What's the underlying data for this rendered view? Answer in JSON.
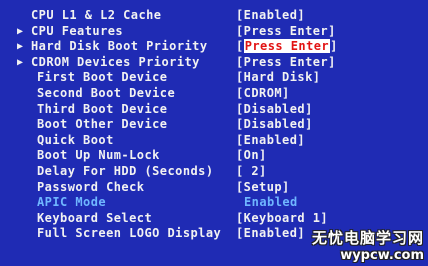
{
  "bios_settings": [
    {
      "label": "CPU L1 & L2 Cache",
      "value": "[Enabled]"
    },
    {
      "label": "CPU Features",
      "value": "[Press Enter]",
      "submenu_marker": "▶"
    },
    {
      "label": "Hard Disk Boot Priority",
      "value_prefix": "[",
      "value_selected": "Press Enter",
      "value_suffix": "]",
      "submenu_marker": "▶"
    },
    {
      "label": "CDROM Devices Priority",
      "value": "[Press Enter]",
      "submenu_marker": "▶"
    },
    {
      "label": "First Boot Device",
      "value": "[Hard Disk]"
    },
    {
      "label": "Second Boot Device",
      "value": "[CDROM]"
    },
    {
      "label": "Third Boot Device",
      "value": "[Disabled]"
    },
    {
      "label": "Boot Other Device",
      "value": "[Disabled]"
    },
    {
      "label": "Quick Boot",
      "value": "[Enabled]"
    },
    {
      "label": "Boot Up Num-Lock",
      "value": "[On]"
    },
    {
      "label": "Delay For HDD (Seconds)",
      "value": "[ 2]"
    },
    {
      "label": "Password Check",
      "value": "[Setup]"
    },
    {
      "label": "APIC Mode",
      "value": "Enabled"
    },
    {
      "label": "Keyboard Select",
      "value": "[Keyboard 1]"
    },
    {
      "label": "Full Screen LOGO Display",
      "value": "[Enabled]"
    }
  ],
  "watermark": {
    "line1": "无忧电脑学习网",
    "line2": "wypcw.com"
  },
  "colors": {
    "background": "#1f2bb4",
    "text": "#f2f2f2",
    "disabled_text": "#6fb6ff",
    "highlight_bg": "#ffffff",
    "highlight_text": "#e21414"
  }
}
